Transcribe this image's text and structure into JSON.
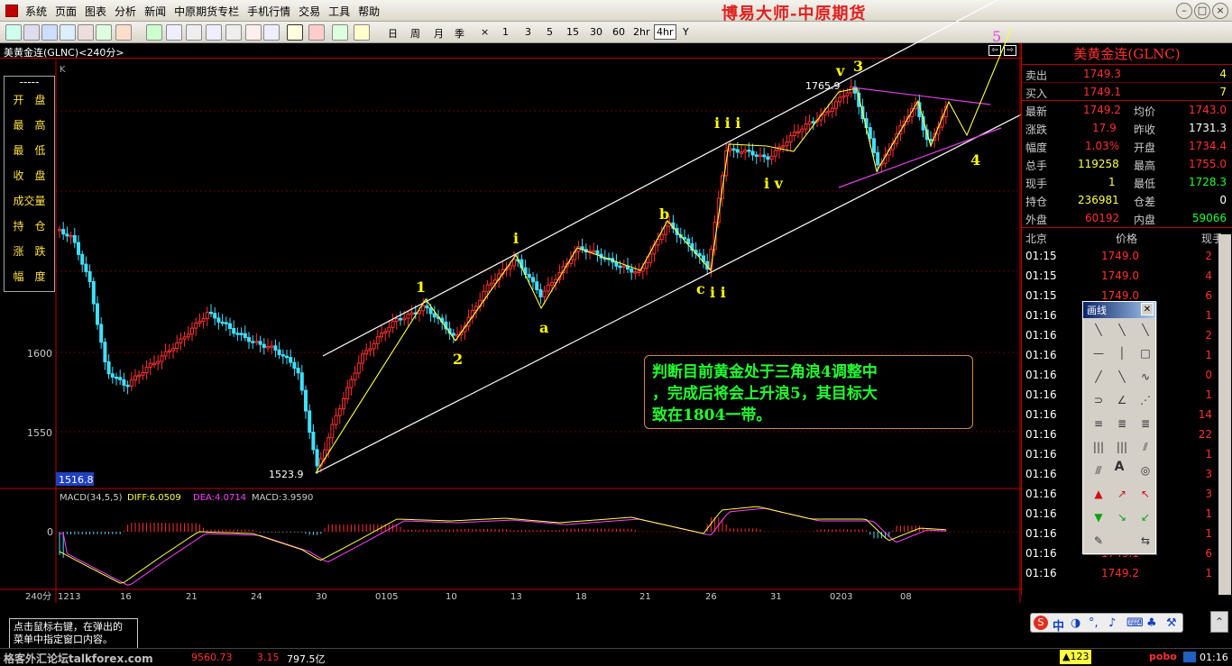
{
  "menu": {
    "items": [
      "系统",
      "页面",
      "图表",
      "分析",
      "新闻",
      "中原期货专栏",
      "手机行情",
      "交易",
      "工具",
      "帮助"
    ],
    "app_title": "博易大师-中原期货"
  },
  "toolbar": {
    "periods": [
      "日",
      "周",
      "月",
      "季",
      "×",
      "1",
      "3",
      "5",
      "15",
      "30",
      "60",
      "2hr",
      "4hr",
      "Y"
    ],
    "active_period": "4hr"
  },
  "header": {
    "symbol_line": "美黄金连(GLNC)<240分>",
    "k_label": "K"
  },
  "left_panel": {
    "dash": "-----",
    "labels": [
      "开　盘",
      "最　高",
      "最　低",
      "收　盘",
      "成交量",
      "持　仓",
      "涨　跌",
      "幅　度"
    ]
  },
  "price_axis": {
    "labels": [
      "1600",
      "1550"
    ],
    "current_marker": "1516.8"
  },
  "chart_labels": {
    "low_price": "1523.9",
    "high_price": "1765.9",
    "waves": {
      "w1": "1",
      "w2": "2",
      "wi": "i",
      "wa": "a",
      "wb": "b",
      "wc": "c",
      "wii": "i i",
      "wiii": "i i i",
      "wiv": "i v",
      "wv": "v",
      "w3": "3",
      "w4": "4",
      "w5": "5"
    }
  },
  "annotation": {
    "line1": "判断目前黄金处于三角浪4调整中",
    "line2": "，完成后将会上升浪5，其目标大",
    "line3": "致在1804一带。"
  },
  "macd": {
    "header_name": "MACD(34,5,5)",
    "diff": "DIFF:6.0509",
    "dea": "DEA:4.0714",
    "macd": "MACD:3.9590",
    "zero_label": "0"
  },
  "time_axis": {
    "period": "240分",
    "labels": [
      "1213",
      "16",
      "21",
      "24",
      "30",
      "0105",
      "10",
      "13",
      "18",
      "21",
      "26",
      "31",
      "0203",
      "08"
    ]
  },
  "quote": {
    "title": "美黄金连(GLNC)",
    "sell": {
      "label": "卖出",
      "price": "1749.3",
      "vol": "4"
    },
    "buy": {
      "label": "买入",
      "price": "1749.1",
      "vol": "7"
    },
    "rows": [
      {
        "l1": "最新",
        "v1": "1749.2",
        "l2": "均价",
        "v2": "1743.0"
      },
      {
        "l1": "涨跌",
        "v1": "17.9",
        "l2": "昨收",
        "v2": "1731.3"
      },
      {
        "l1": "幅度",
        "v1": "1.03%",
        "l2": "开盘",
        "v2": "1734.4"
      },
      {
        "l1": "总手",
        "v1": "119258",
        "l2": "最高",
        "v2": "1755.0"
      },
      {
        "l1": "现手",
        "v1": "1",
        "l2": "最低",
        "v2": "1728.3"
      },
      {
        "l1": "持仓",
        "v1": "236981",
        "l2": "仓差",
        "v2": "0"
      },
      {
        "l1": "外盘",
        "v1": "60192",
        "l2": "内盘",
        "v2": "59066"
      }
    ],
    "tick_header": {
      "time": "北京",
      "price": "价格",
      "vol": "现手"
    },
    "ticks": [
      {
        "t": "01:15",
        "p": "1749.0",
        "v": "2"
      },
      {
        "t": "01:15",
        "p": "1749.0",
        "v": "4"
      },
      {
        "t": "01:15",
        "p": "1749.0",
        "v": "6"
      },
      {
        "t": "01:16",
        "p": "",
        "v": "1"
      },
      {
        "t": "01:16",
        "p": "",
        "v": "2"
      },
      {
        "t": "01:16",
        "p": "",
        "v": "1"
      },
      {
        "t": "01:16",
        "p": "",
        "v": "0"
      },
      {
        "t": "01:16",
        "p": "",
        "v": "1"
      },
      {
        "t": "01:16",
        "p": "",
        "v": "14"
      },
      {
        "t": "01:16",
        "p": "",
        "v": "22"
      },
      {
        "t": "01:16",
        "p": "",
        "v": "1"
      },
      {
        "t": "01:16",
        "p": "",
        "v": "3"
      },
      {
        "t": "01:16",
        "p": "",
        "v": "3"
      },
      {
        "t": "01:16",
        "p": "",
        "v": "1"
      },
      {
        "t": "01:16",
        "p": "",
        "v": "1"
      },
      {
        "t": "01:16",
        "p": "1749.1",
        "v": "6"
      },
      {
        "t": "01:16",
        "p": "1749.2",
        "v": "1"
      }
    ]
  },
  "draw_tool": {
    "title": "画线",
    "letter_a": "A"
  },
  "bottom": {
    "tip_line1": "点击鼠标右键，在弹出的",
    "tip_line2": "菜单中指定窗口内容。",
    "watermark": "格客外汇论坛talkforex.com",
    "index_val": "9560.73",
    "index_chg": "3.15",
    "turnover": "797.5亿",
    "up_count": "▲123",
    "pobo": "pobo",
    "time": "01:16"
  }
}
